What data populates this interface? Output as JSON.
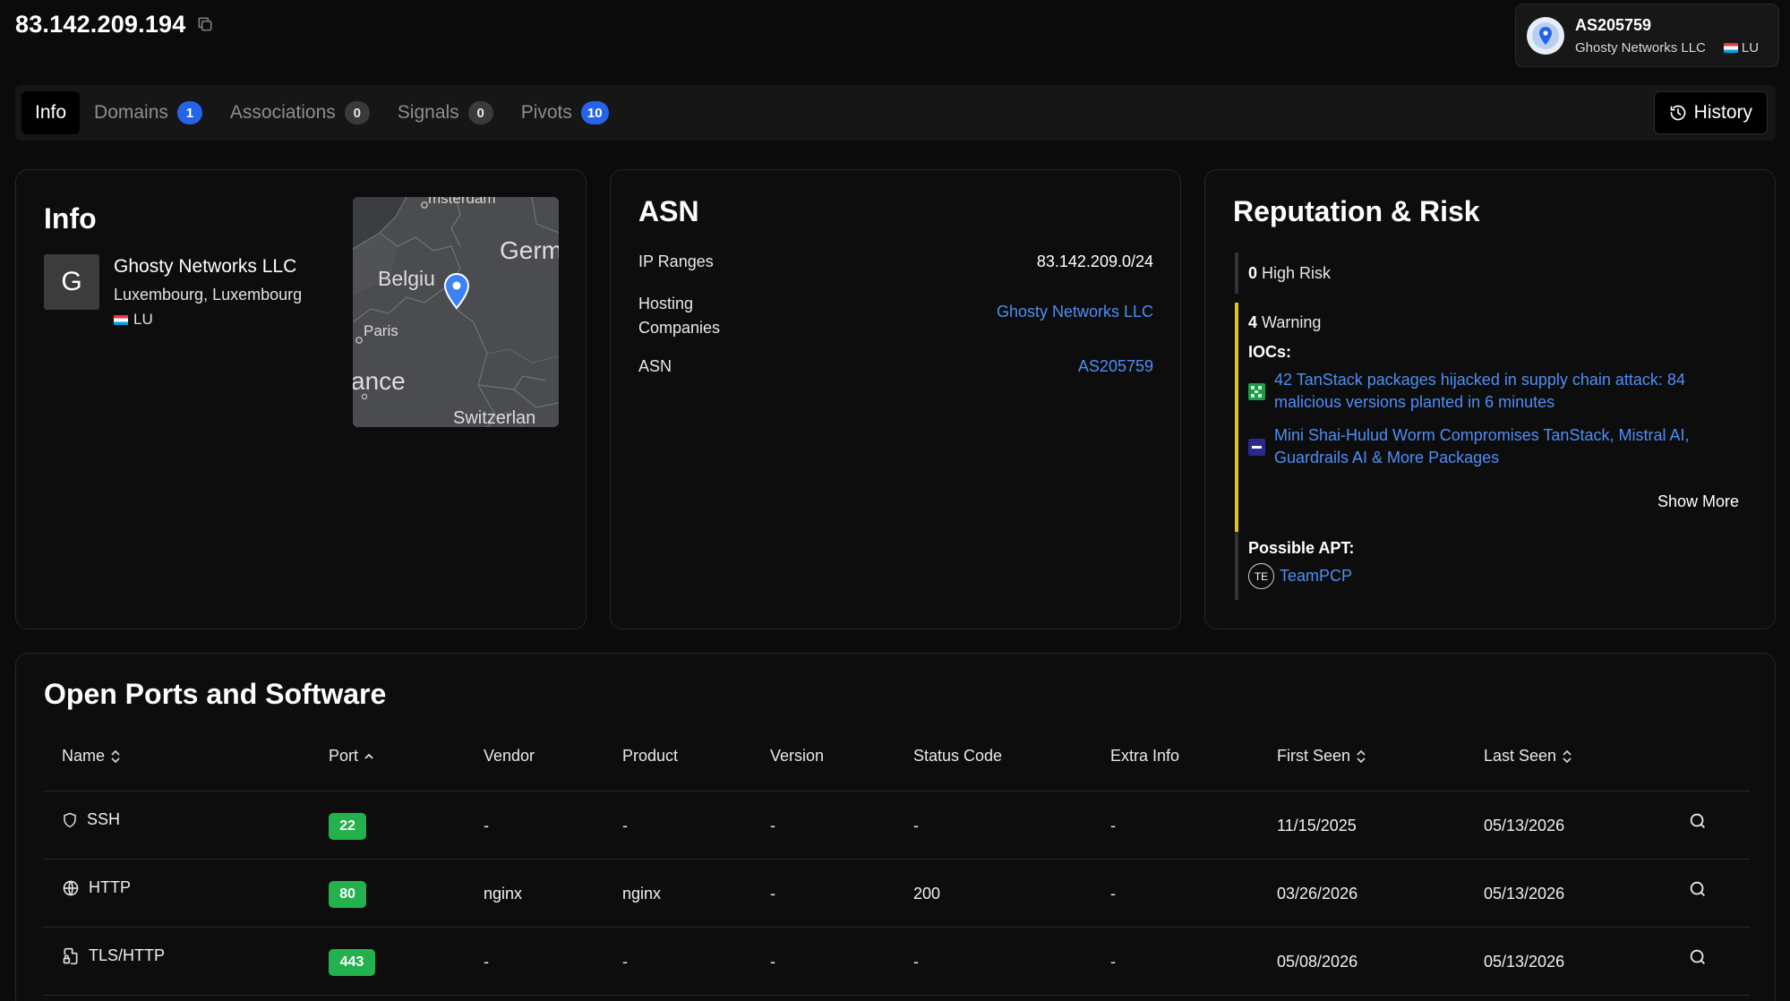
{
  "header": {
    "ip": "83.142.209.194",
    "asn_card": {
      "asn": "AS205759",
      "org": "Ghosty Networks LLC",
      "country": "LU"
    }
  },
  "tabs": [
    {
      "label": "Info",
      "active": true
    },
    {
      "label": "Domains",
      "count": "1",
      "badge_color": "blue"
    },
    {
      "label": "Associations",
      "count": "0",
      "badge_color": "grey"
    },
    {
      "label": "Signals",
      "count": "0",
      "badge_color": "grey"
    },
    {
      "label": "Pivots",
      "count": "10",
      "badge_color": "blue"
    }
  ],
  "history_label": "History",
  "info": {
    "title": "Info",
    "avatar_letter": "G",
    "org_name": "Ghosty Networks LLC",
    "location": "Luxembourg, Luxembourg",
    "country": "LU",
    "map_labels": [
      "msterdam",
      "Germ",
      "Belgiu",
      "Paris",
      "ance",
      "Switzerlan"
    ]
  },
  "asn": {
    "title": "ASN",
    "rows": [
      {
        "key": "IP Ranges",
        "value": "83.142.209.0/24"
      },
      {
        "key_line1": "Hosting",
        "key_line2": "Companies",
        "value": "Ghosty Networks LLC"
      },
      {
        "key": "ASN",
        "value": "AS205759"
      }
    ]
  },
  "reputation": {
    "title": "Reputation & Risk",
    "high_risk_count": "0",
    "high_risk_label": "High Risk",
    "warning_count": "4",
    "warning_label": "Warning",
    "iocs_label": "IOCs:",
    "iocs": [
      {
        "line1": "42 TanStack packages hijacked in supply chain attack: 84",
        "line2": "malicious versions planted in 6 minutes"
      },
      {
        "line1": "Mini Shai-Hulud Worm Compromises TanStack, Mistral AI,",
        "line2": "Guardrails AI & More Packages"
      }
    ],
    "show_more": "Show More",
    "apt_label": "Possible APT:",
    "apt_initials": "TE",
    "apt_name": "TeamPCP"
  },
  "ports": {
    "title": "Open Ports and Software",
    "columns": [
      "Name",
      "Port",
      "Vendor",
      "Product",
      "Version",
      "Status Code",
      "Extra Info",
      "First Seen",
      "Last Seen"
    ],
    "rows": [
      {
        "icon": "shield-icon",
        "name": "SSH",
        "port": "22",
        "vendor": "-",
        "product": "-",
        "version": "-",
        "status": "-",
        "extra": "-",
        "first_seen": "11/15/2025",
        "last_seen": "05/13/2026"
      },
      {
        "icon": "globe-icon",
        "name": "HTTP",
        "port": "80",
        "vendor": "nginx",
        "product": "nginx",
        "version": "-",
        "status": "200",
        "extra": "-",
        "first_seen": "03/26/2026",
        "last_seen": "05/13/2026"
      },
      {
        "icon": "file-lock-icon",
        "name": "TLS/HTTP",
        "port": "443",
        "vendor": "-",
        "product": "-",
        "version": "-",
        "status": "-",
        "extra": "-",
        "first_seen": "05/08/2026",
        "last_seen": "05/13/2026"
      }
    ]
  },
  "colors": {
    "link": "#4d8ff5",
    "badge_blue": "#2563eb",
    "port_green": "#22b14c",
    "warning_yellow": "#e8c21a"
  }
}
